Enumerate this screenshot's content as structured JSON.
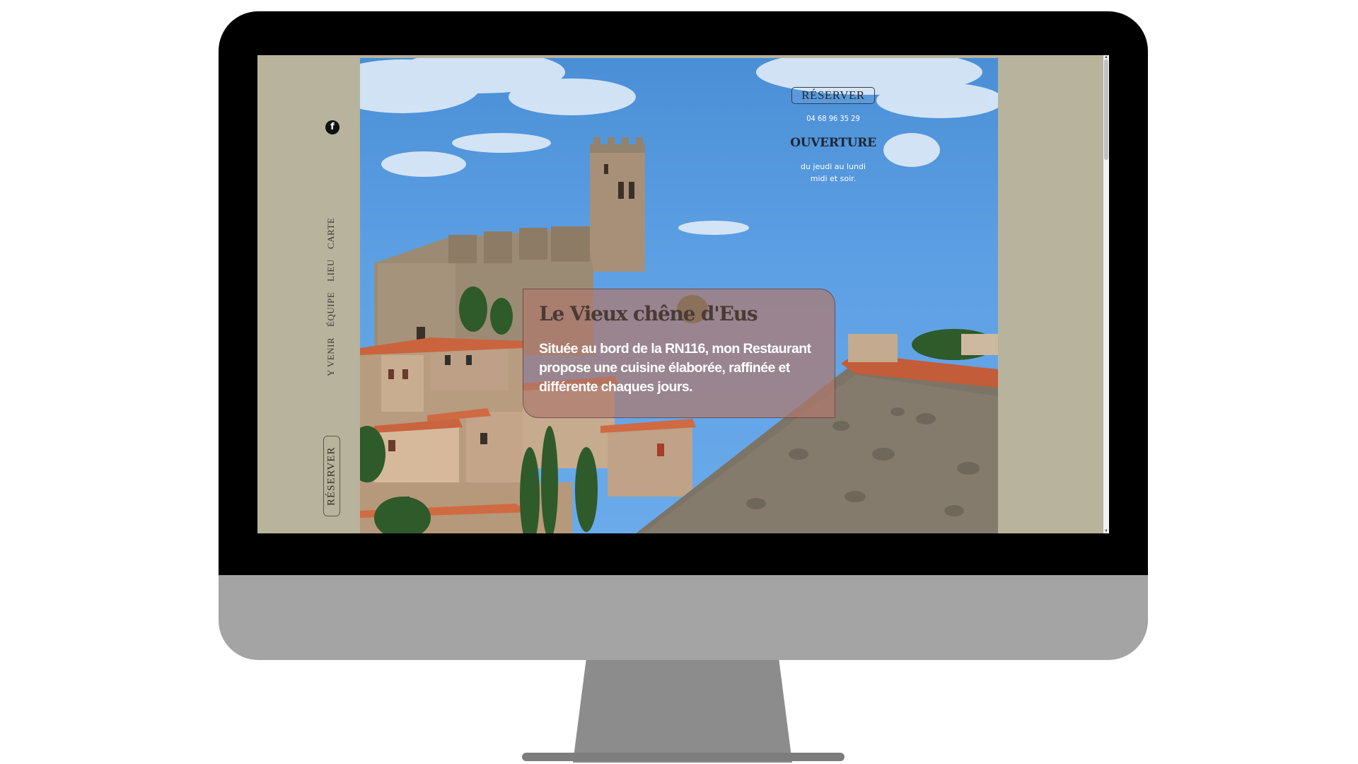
{
  "colors": {
    "panel": "#b8b39c",
    "bezel": "#000000",
    "stand": "#a4a4a4",
    "card": "#af786e",
    "sky": "#5ea0e4"
  },
  "icons": {
    "facebook": "facebook-icon"
  },
  "side_nav": {
    "facebook_glyph": "f",
    "items": [
      {
        "label": "CARTE"
      },
      {
        "label": "LIEU"
      },
      {
        "label": "ÉQUIPE"
      },
      {
        "label": "Y VENIR"
      }
    ],
    "reserve_label": "RÉSERVER"
  },
  "header": {
    "reserve_label": "RÉSERVER",
    "phone": "04 68 96 35 29",
    "hours_title": "OUVERTURE",
    "hours_line1": "du jeudi au lundi",
    "hours_line2": "midi et soir."
  },
  "intro": {
    "title": "Le Vieux chêne d'Eus",
    "text": "Située au bord de la RN116, mon Restaurant propose une cuisine élaborée, raffinée et différente chaques jours."
  },
  "scrollbar": {
    "up_arrow": "▲",
    "down_arrow": "▼"
  }
}
